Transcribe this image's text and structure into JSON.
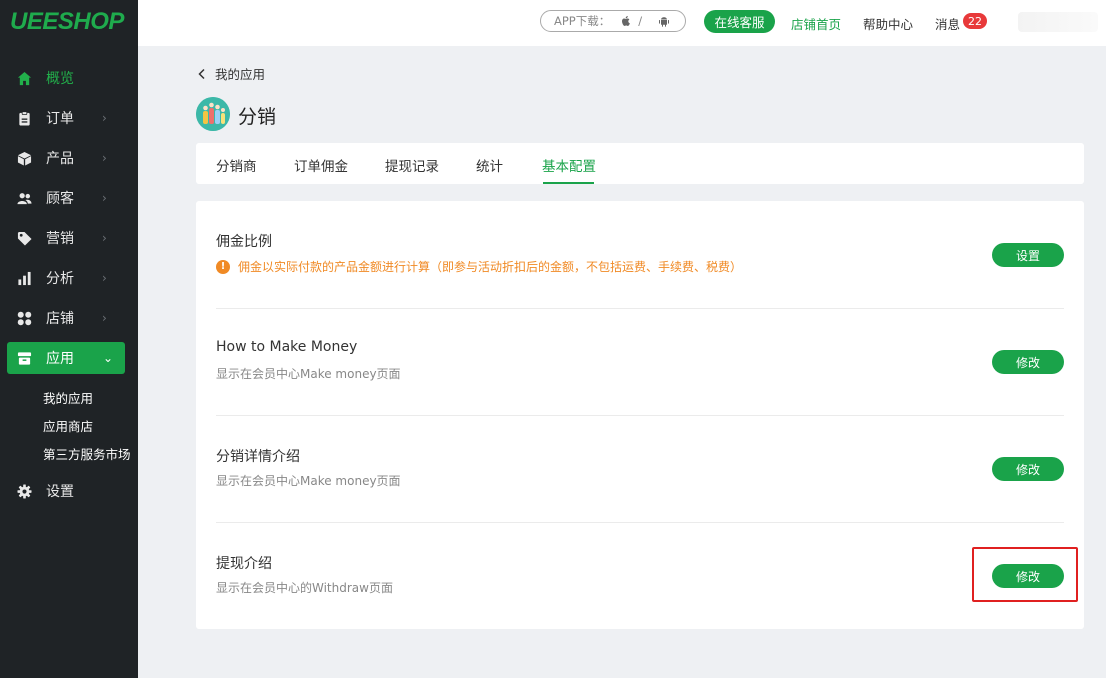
{
  "brand": {
    "logo": "UEESHOP",
    "accent": "#1aa34a"
  },
  "sidebar": {
    "items": [
      {
        "label": "概览",
        "icon": "home-icon"
      },
      {
        "label": "订单",
        "icon": "clipboard-icon",
        "chevron": "›"
      },
      {
        "label": "产品",
        "icon": "box-icon",
        "chevron": "›"
      },
      {
        "label": "顾客",
        "icon": "users-icon",
        "chevron": "›"
      },
      {
        "label": "营销",
        "icon": "tag-icon",
        "chevron": "›"
      },
      {
        "label": "分析",
        "icon": "bar-chart-icon",
        "chevron": "›"
      },
      {
        "label": "店铺",
        "icon": "grid-icon",
        "chevron": "›"
      },
      {
        "label": "应用",
        "icon": "store-icon",
        "chevron": "⌄"
      },
      {
        "label": "设置",
        "icon": "gear-icon"
      }
    ],
    "sub_items": [
      "我的应用",
      "应用商店",
      "第三方服务市场"
    ]
  },
  "topbar": {
    "app_download": "APP下载：",
    "app_sep": "/",
    "service_button": "在线客服",
    "store_home": "店铺首页",
    "help": "帮助中心",
    "messages": "消息",
    "message_count": "22"
  },
  "main": {
    "back_label": "我的应用",
    "page_title": "分销",
    "tabs": [
      "分销商",
      "订单佣金",
      "提现记录",
      "统计",
      "基本配置"
    ],
    "active_tab": "基本配置",
    "rows": [
      {
        "title": "佣金比例",
        "warning": "佣金以实际付款的产品金额进行计算（即参与活动折扣后的金额，不包括运费、手续费、税费）",
        "button": "设置"
      },
      {
        "title": "How to Make Money",
        "desc": "显示在会员中心Make money页面",
        "button": "修改"
      },
      {
        "title": "分销详情介绍",
        "desc": "显示在会员中心Make money页面",
        "button": "修改"
      },
      {
        "title": "提现介绍",
        "desc": "显示在会员中心的Withdraw页面",
        "button": "修改"
      }
    ]
  }
}
